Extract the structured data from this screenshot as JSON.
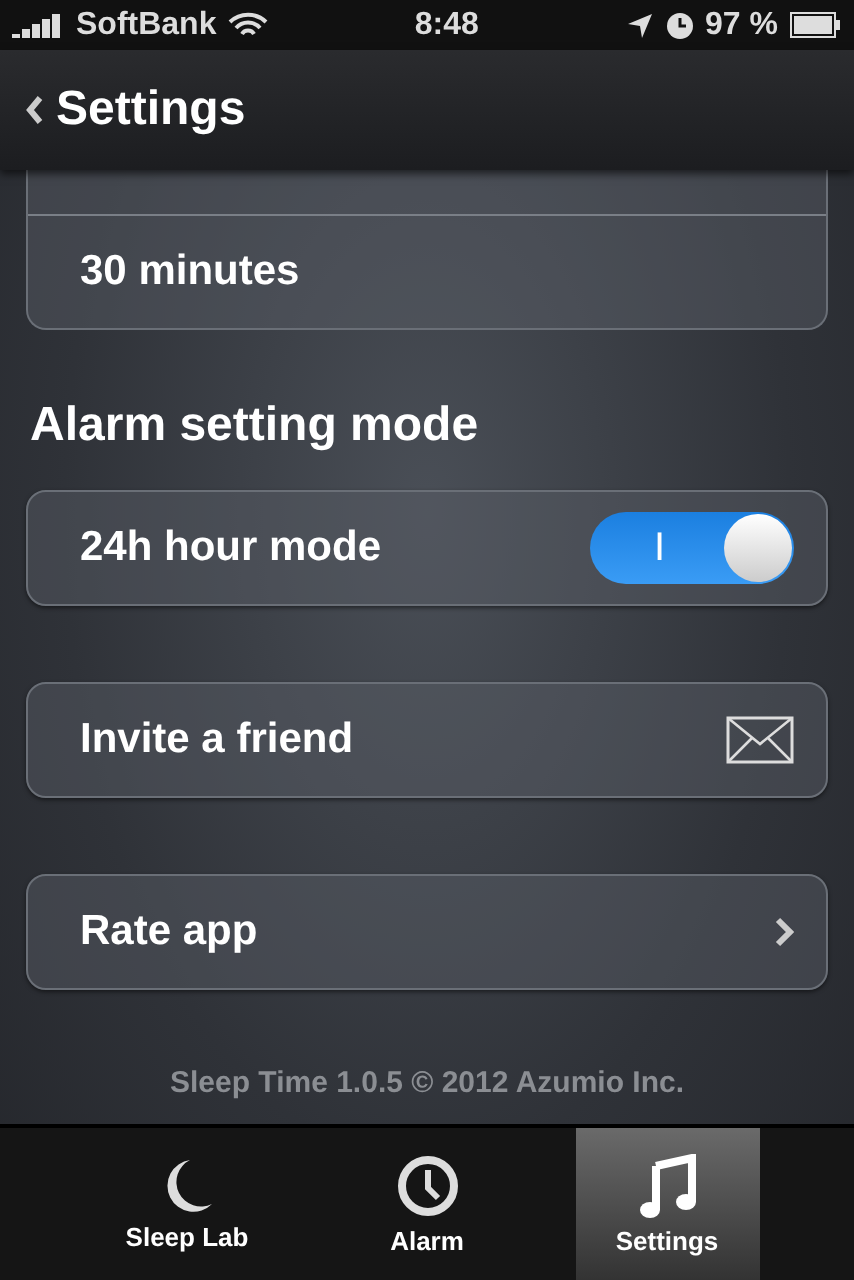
{
  "status_bar": {
    "carrier": "SoftBank",
    "time": "8:48",
    "battery": "97 %"
  },
  "nav": {
    "back": "Settings"
  },
  "duration_list": {
    "items": [
      "30 minutes"
    ]
  },
  "section_title": "Alarm setting mode",
  "rows": [
    {
      "kind": "toggle",
      "label": "24h hour mode",
      "on": true,
      "on_text": "I"
    },
    {
      "kind": "mail",
      "label": "Invite a friend"
    },
    {
      "kind": "chevron",
      "label": "Rate app"
    }
  ],
  "footer": "Sleep Time 1.0.5 © 2012 Azumio Inc.",
  "tabs": [
    {
      "label": "Sleep Lab",
      "kind": "moon",
      "selected": false
    },
    {
      "label": "Alarm",
      "kind": "clock",
      "selected": false
    },
    {
      "label": "Settings",
      "kind": "music",
      "selected": true
    }
  ]
}
